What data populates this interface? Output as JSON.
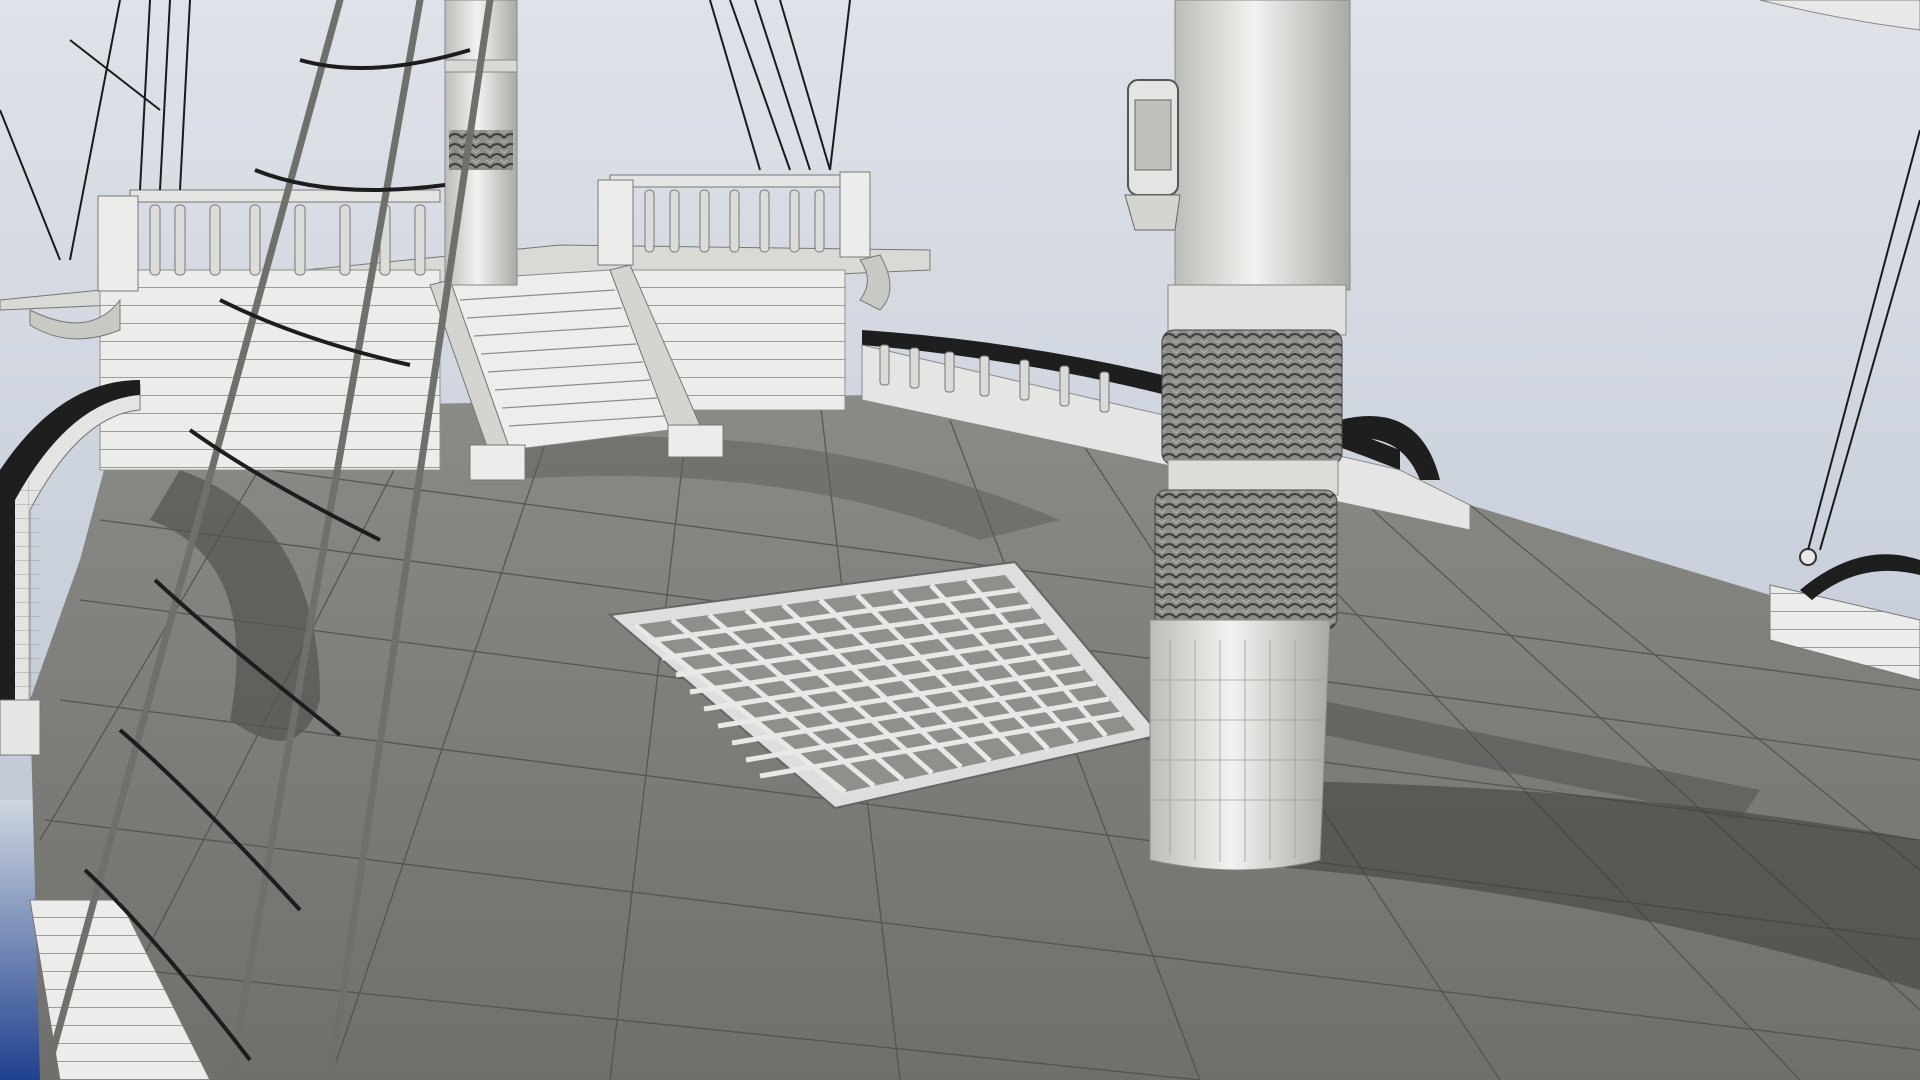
{
  "scene": {
    "description_hidden": "",
    "colors": {
      "sky_top": "#d7dbe3",
      "sky_bottom": "#b9c3d3",
      "deck": "#777773",
      "deck_line": "#4d4d4a",
      "wood_light": "#e8e8e6",
      "wood_mid": "#cfcfcb",
      "shadow": "#555552",
      "rope": "#6f6f6c",
      "rope_dark": "#1e1e1e",
      "rail_dark": "#202020",
      "water_blue": "#1f3f8a"
    },
    "objects": [
      "main-deck",
      "mast",
      "rope-coil",
      "cargo-grating",
      "stern-castle",
      "stairs",
      "balustrade",
      "rope-ladder-shrouds",
      "lantern",
      "side-rail"
    ]
  }
}
